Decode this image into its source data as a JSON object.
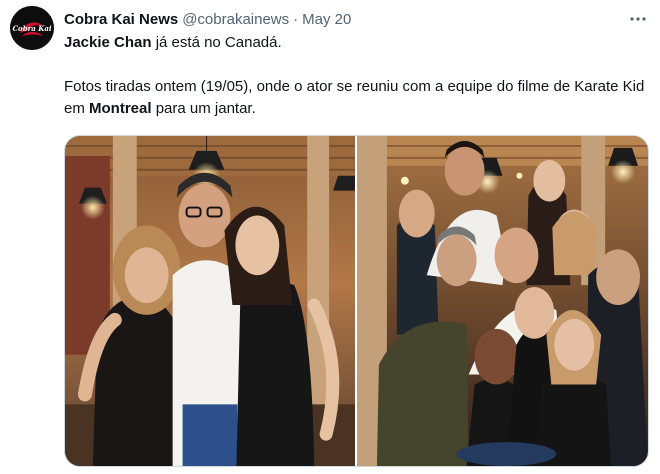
{
  "tweet": {
    "author": {
      "name": "Cobra Kai News",
      "handle": "@cobrakainews",
      "avatar_icon": "cobra-kai-logo-icon",
      "avatar_logo_text": "Cobra Kai"
    },
    "separator": "·",
    "date": "May 20",
    "more_icon": "more-dots-icon",
    "text": {
      "line1_bold": "Jackie Chan",
      "line1_rest": " já está no Canadá.",
      "line2_a": "Fotos tiradas ontem (19/05), onde o ator se reuniu com a equipe do filme de Karate Kid em ",
      "line2_bold": "Montreal",
      "line2_b": " para um jantar."
    },
    "media": [
      {
        "name": "photo-jackie-chan-with-two-women"
      },
      {
        "name": "photo-group-dinner-montreal"
      }
    ]
  },
  "colors": {
    "text": "#0f1419",
    "secondary": "#536471",
    "border": "#cfd9de",
    "avatar_bg": "#0d0d0d",
    "logo_red": "#c8102e"
  }
}
